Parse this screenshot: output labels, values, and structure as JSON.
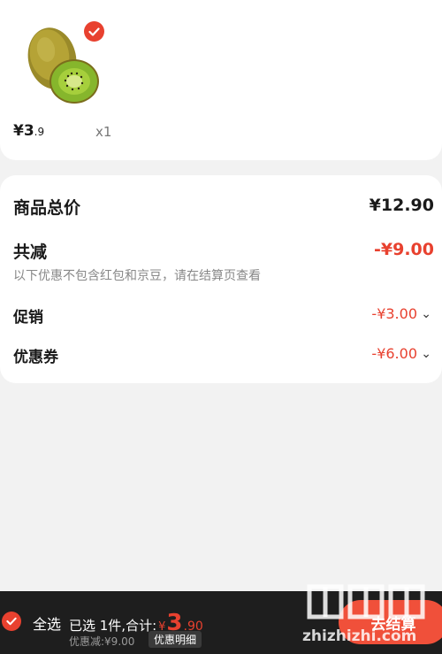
{
  "product": {
    "price_symbol": "¥3",
    "price_decimal": ".9",
    "quantity": "x1",
    "selected": true
  },
  "summary": {
    "total_label": "商品总价",
    "total_value": "¥12.90",
    "reduction_label": "共减",
    "reduction_value": "-¥9.00",
    "note": "以下优惠不包含红包和京豆，请在结算页查看",
    "promo_label": "促销",
    "promo_value": "-¥3.00",
    "coupon_label": "优惠券",
    "coupon_value": "-¥6.00"
  },
  "bottom_bar": {
    "select_all": "全选",
    "selected_text": "已选 1件,合计:",
    "total_yen": "¥",
    "total_int": "3",
    "total_dec": ".90",
    "discount_text": "优惠减:¥9.00",
    "discount_detail": "优惠明细",
    "checkout": "去结算"
  },
  "watermark": {
    "text": "zhizhizhi.com"
  },
  "colors": {
    "accent": "#e8412f",
    "bar": "#1e1e1e",
    "background": "#f2f2f2"
  }
}
